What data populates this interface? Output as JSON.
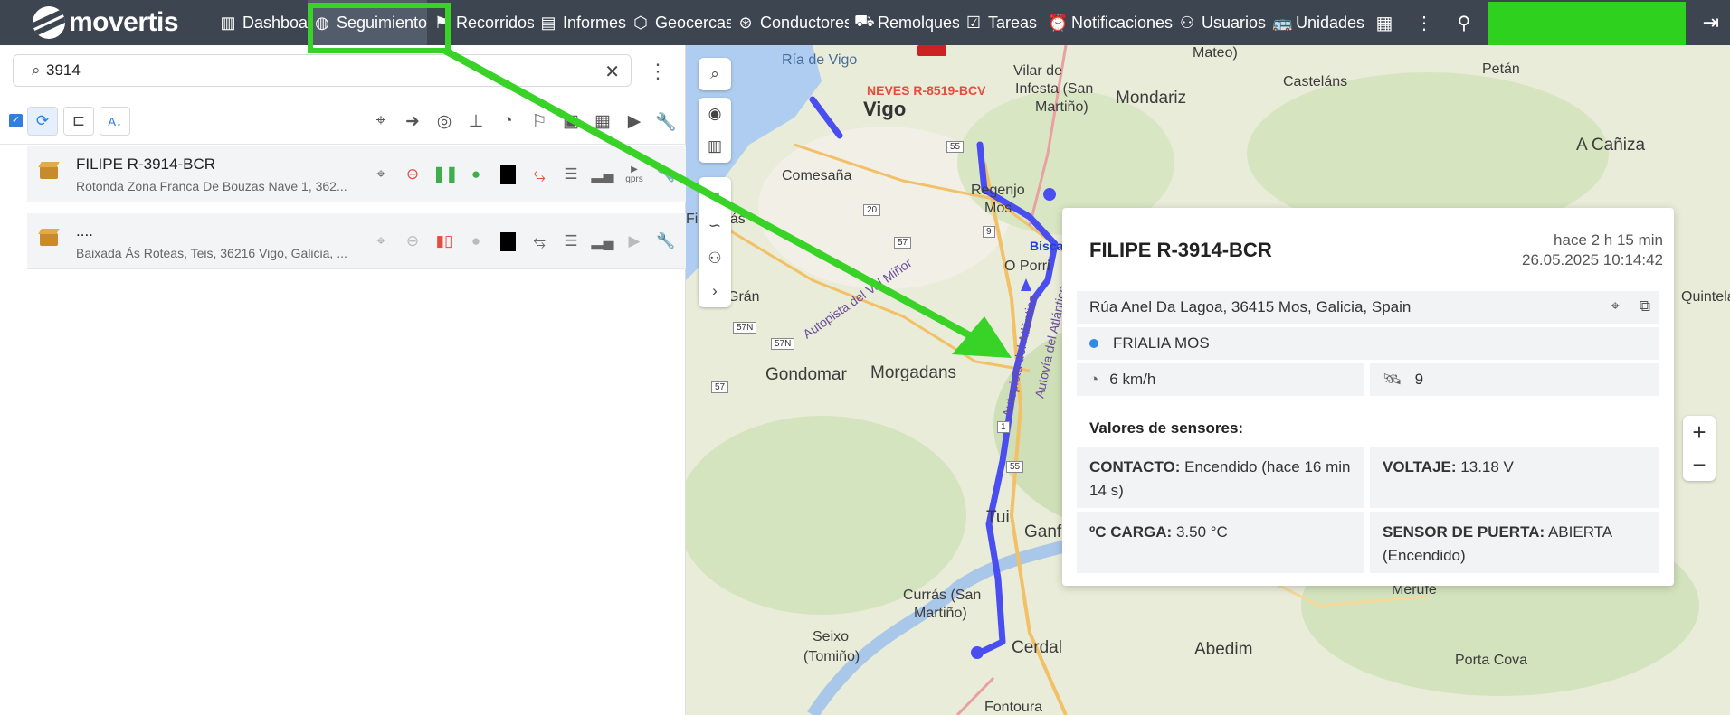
{
  "nav": {
    "logo": "movertis",
    "items": [
      {
        "label": "Dashboa",
        "icon": "bar-chart-icon"
      },
      {
        "label": "Seguimiento",
        "icon": "globe-icon"
      },
      {
        "label": "Recorridos",
        "icon": "flag-icon"
      },
      {
        "label": "Informes",
        "icon": "report-icon"
      },
      {
        "label": "Geocercas",
        "icon": "geofence-icon"
      },
      {
        "label": "Conductores",
        "icon": "steering-icon"
      },
      {
        "label": "Remolques",
        "icon": "trailer-icon"
      },
      {
        "label": "Tareas",
        "icon": "task-icon"
      },
      {
        "label": "Notificaciones",
        "icon": "alarm-icon"
      },
      {
        "label": "Usuarios",
        "icon": "user-icon"
      },
      {
        "label": "Unidades",
        "icon": "bus-icon"
      }
    ]
  },
  "search": {
    "value": "3914"
  },
  "units": [
    {
      "name": "FILIPE R-3914-BCR",
      "address": "Rotonda Zona Franca De Bouzas Nave 1, 362...",
      "speed_icon": "gprs"
    },
    {
      "name": "....",
      "address": "Baixada Ás Roteas, Teis, 36216 Vigo, Galicia, ..."
    }
  ],
  "map": {
    "labels": [
      {
        "text": "Ría de Vigo"
      },
      {
        "text": "NEVES R-8519-BCV"
      },
      {
        "text": "Vigo"
      },
      {
        "text": "Vilar de"
      },
      {
        "text": "Infesta (San"
      },
      {
        "text": "Martiño)"
      },
      {
        "text": "Mondariz"
      },
      {
        "text": "Casteláns"
      },
      {
        "text": "Petán"
      },
      {
        "text": "A Cañiza"
      },
      {
        "text": "Comesaña"
      },
      {
        "text": "Regenjo"
      },
      {
        "text": "Mos"
      },
      {
        "text": "Bisca"
      },
      {
        "text": "O Porri"
      },
      {
        "text": "Figueirás"
      },
      {
        "text": "Autopista del Val Miñor"
      },
      {
        "text": "Gondomar"
      },
      {
        "text": "Morgadans"
      },
      {
        "text": "Autopista del Atlántico"
      },
      {
        "text": "Autovía del Atlántico"
      },
      {
        "text": "Tui"
      },
      {
        "text": "Ganfe"
      },
      {
        "text": "Currás (San"
      },
      {
        "text": "Martiño)"
      },
      {
        "text": "Seixo"
      },
      {
        "text": "(Tomiño)"
      },
      {
        "text": "Cerdal"
      },
      {
        "text": "Abedim"
      },
      {
        "text": "Merufe"
      },
      {
        "text": "Porta Cova"
      },
      {
        "text": "Quintela"
      },
      {
        "text": "Mateo)"
      },
      {
        "text": "Grán"
      },
      {
        "text": "Fontoura"
      }
    ],
    "road_numbers": [
      "55",
      "20",
      "57",
      "9",
      "57N",
      "57N",
      "57",
      "55",
      "1"
    ]
  },
  "popup": {
    "title": "FILIPE R-3914-BCR",
    "ago": "hace 2 h 15 min",
    "timestamp": "26.05.2025 10:14:42",
    "address": "Rúa Anel Da Lagoa, 36415 Mos, Galicia, Spain",
    "geofence": "FRIALIA MOS",
    "speed": "6 km/h",
    "satellites": "9",
    "sensors_title": "Valores de sensores:",
    "sensors": [
      {
        "key": "CONTACTO:",
        "value": "Encendido (hace 16 min 14 s)"
      },
      {
        "key": "VOLTAJE:",
        "value": "13.18 V"
      },
      {
        "key": "ºC CARGA:",
        "value": "3.50 °C"
      },
      {
        "key": "SENSOR DE PUERTA:",
        "value": "ABIERTA (Encendido)"
      }
    ]
  },
  "colors": {
    "topbar": "#3d4551",
    "highlight": "#38d326",
    "route": "#4a4df0",
    "accent": "#2f7ee0"
  }
}
